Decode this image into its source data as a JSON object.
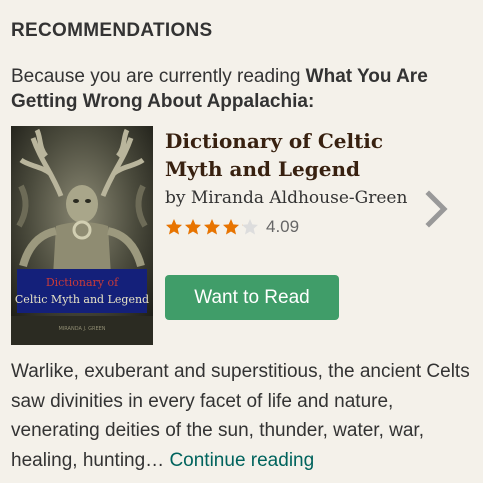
{
  "section": {
    "heading": "RECOMMENDATIONS",
    "because_prefix": "Because you are currently reading ",
    "because_title": "What You Are Getting Wrong About Appalachia:"
  },
  "book": {
    "title": "Dictionary of Celtic Myth and Legend",
    "author": "by Miranda Aldhouse-Green",
    "rating": "4.09",
    "rating_value": 4.09,
    "rating_max": 5,
    "cover": {
      "title_line1": "Dictionary of",
      "title_line2": "Celtic Myth and Legend",
      "author_small": "MIRANDA J. GREEN"
    }
  },
  "actions": {
    "want_to_read": "Want to Read",
    "next_icon": "chevron-right-icon"
  },
  "description": {
    "text": "Warlike, exuberant and superstitious, the ancient Celts saw divinities in every facet of life and nature, venerating deities of the sun, thunder, water, war, healing, hunting… ",
    "continue_label": "Continue reading"
  },
  "colors": {
    "background": "#f4f1ea",
    "button": "#409d69",
    "star": "#e87400",
    "link": "#00635d",
    "title": "#382110"
  }
}
